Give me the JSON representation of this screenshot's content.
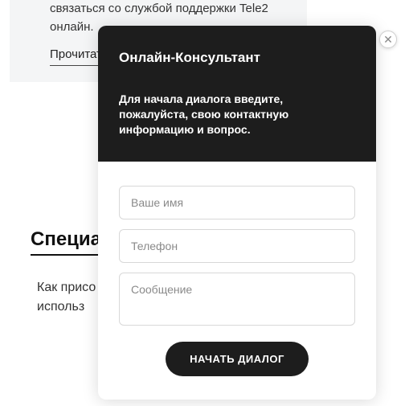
{
  "background": {
    "card_text": "связаться со службой поддержки Tele2 онлайн.",
    "readmore": "Прочитат",
    "heading": "Специал",
    "para_line1": "Как присо",
    "para_line2": "использ"
  },
  "chat": {
    "title": "Онлайн-Консультант",
    "instruction": "Для начала диалога введите, пожалуйста, свою контактную информацию и вопрос.",
    "name_placeholder": "Ваше имя",
    "phone_placeholder": "Телефон",
    "message_placeholder": "Сообщение",
    "submit_label": "НАЧАТЬ ДИАЛОГ",
    "close_symbol": "✕"
  }
}
